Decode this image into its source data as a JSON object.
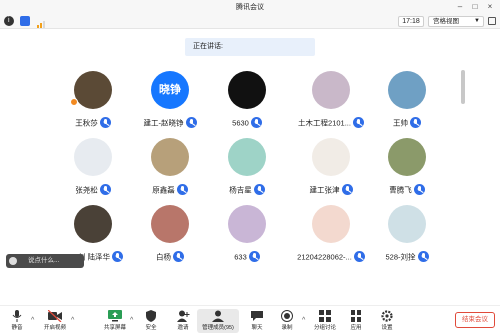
{
  "window": {
    "title": "腾讯会议"
  },
  "toolbar": {
    "time": "17:18",
    "view_label": "宫格视图"
  },
  "speaking": {
    "label": "正在讲话:"
  },
  "participants": [
    {
      "name": "王秋莎",
      "color": "#5b4a36"
    },
    {
      "name": "建工-赵晓铮",
      "avatar_text": "晓铮",
      "color": "#1677ff"
    },
    {
      "name": "5630",
      "color": "#111111"
    },
    {
      "name": "土木工程2101...",
      "color": "#c9b8c9"
    },
    {
      "name": "王帅",
      "color": "#6fa0c4"
    },
    {
      "name": "张尧松",
      "color": "#e7ebf0"
    },
    {
      "name": "原鑫磊",
      "color": "#b7a07a"
    },
    {
      "name": "杨吉星",
      "color": "#9ed3c7"
    },
    {
      "name": "建工张津",
      "color": "#f1ece6"
    },
    {
      "name": "曹腾飞",
      "color": "#8b9a6a"
    },
    {
      "name": "528-刘 陆泽华",
      "color": "#4a4137"
    },
    {
      "name": "白杨",
      "color": "#b8766a"
    },
    {
      "name": "633",
      "color": "#c9b6d6"
    },
    {
      "name": "21204228062-...",
      "color": "#f3d9cf"
    },
    {
      "name": "528-刘拴",
      "color": "#cfe0e6"
    }
  ],
  "chat": {
    "placeholder": "说点什么..."
  },
  "bottom_bar": {
    "mute": "静音",
    "video": "开启视频",
    "share": "共享屏幕",
    "security": "安全",
    "invite": "邀请",
    "members": "管理成员(95)",
    "chat": "聊天",
    "record": "录制",
    "breakout": "分组讨论",
    "apps": "应用",
    "settings": "设置",
    "end": "结束会议"
  }
}
